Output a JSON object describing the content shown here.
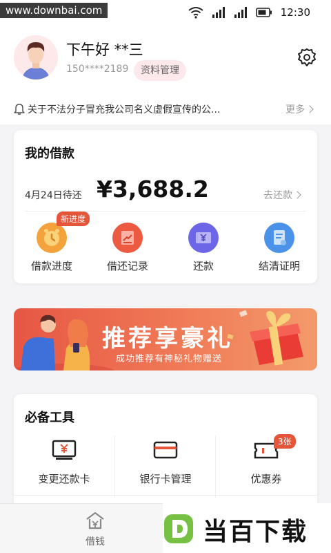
{
  "status_bar": {
    "watermark": "www.downbai.com",
    "time": "12:30",
    "icons": [
      "wifi-icon",
      "signal-icon",
      "signal-icon",
      "battery-icon"
    ]
  },
  "header": {
    "greeting": "下午好  **三",
    "phone": "150****2189",
    "profile_button": "资料管理"
  },
  "notice": {
    "text": "关于不法分子冒充我公司名义虚假宣传的公...",
    "more": "更多"
  },
  "loan": {
    "title": "我的借款",
    "due_label": "4月24日待还",
    "amount": "¥3,688.2",
    "repay_link": "去还款",
    "actions": [
      {
        "label": "借款进度",
        "icon": "clock-icon",
        "color": "#f3a23c",
        "badge": "新进度"
      },
      {
        "label": "借还记录",
        "icon": "record-icon",
        "color": "#ec5a42"
      },
      {
        "label": "还款",
        "icon": "yen-icon",
        "color": "#6d67e8"
      },
      {
        "label": "结清证明",
        "icon": "certificate-icon",
        "color": "#4a93e8"
      }
    ]
  },
  "banner": {
    "title": "推荐享豪礼",
    "subtitle": "成功推荐有神秘礼物赠送"
  },
  "tools": {
    "title": "必备工具",
    "items": [
      {
        "label": "变更还款卡",
        "icon": "card-yen-icon"
      },
      {
        "label": "银行卡管理",
        "icon": "bank-card-icon"
      },
      {
        "label": "优惠券",
        "icon": "coupon-icon",
        "badge": "3张"
      }
    ]
  },
  "tabbar": {
    "items": [
      {
        "label": "借钱",
        "icon": "home-icon"
      }
    ]
  },
  "logo_watermark": {
    "text": "当百下载"
  }
}
